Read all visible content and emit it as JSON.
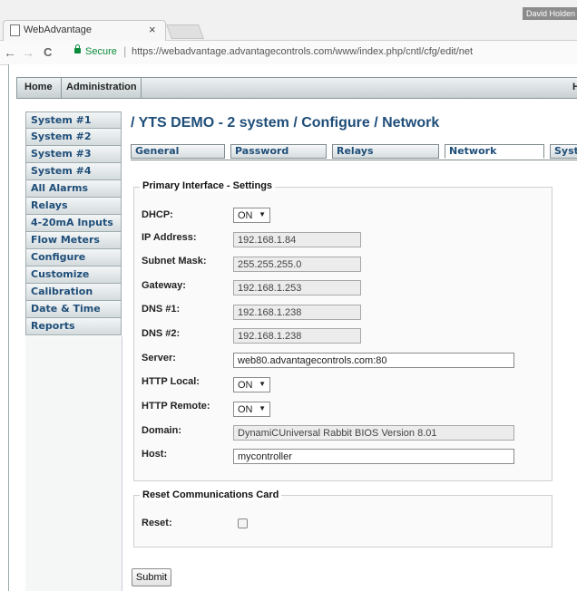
{
  "browser": {
    "tab_title": "WebAdvantage",
    "tab_close": "×",
    "user": "David Holden",
    "back": "←",
    "forward": "→",
    "reload": "C",
    "secure": "Secure",
    "separator": "|",
    "url": "https://webadvantage.advantagecontrols.com/www/index.php/cntl/cfg/edit/net"
  },
  "topbar": {
    "home": "Home",
    "admin": "Administration",
    "right": "H"
  },
  "sidebar": {
    "items": [
      {
        "label": "System #1"
      },
      {
        "label": "System #2"
      },
      {
        "label": "System #3"
      },
      {
        "label": "System #4"
      },
      {
        "label": "All Alarms"
      },
      {
        "label": "Relays"
      },
      {
        "label": "4-20mA Inputs"
      },
      {
        "label": "Flow Meters"
      },
      {
        "label": "Configure"
      },
      {
        "label": "Customize"
      },
      {
        "label": "Calibration"
      },
      {
        "label": "Date & Time"
      },
      {
        "label": "Reports"
      }
    ]
  },
  "page_title": "/ YTS DEMO - 2 system / Configure / Network",
  "tabs": [
    {
      "label": "General"
    },
    {
      "label": "Password"
    },
    {
      "label": "Relays"
    },
    {
      "label": "Network"
    },
    {
      "label": "Syst"
    }
  ],
  "primary": {
    "legend": "Primary Interface - Settings",
    "dhcp_label": "DHCP:",
    "dhcp_value": "ON",
    "ip_label": "IP Address:",
    "ip_value": "192.168.1.84",
    "subnet_label": "Subnet Mask:",
    "subnet_value": "255.255.255.0",
    "gateway_label": "Gateway:",
    "gateway_value": "192.168.1.253",
    "dns1_label": "DNS #1:",
    "dns1_value": "192.168.1.238",
    "dns2_label": "DNS #2:",
    "dns2_value": "192.168.1.238",
    "server_label": "Server:",
    "server_value": "web80.advantagecontrols.com:80",
    "http_local_label": "HTTP Local:",
    "http_local_value": "ON",
    "http_remote_label": "HTTP Remote:",
    "http_remote_value": "ON",
    "domain_label": "Domain:",
    "domain_value": "DynamiCUniversal Rabbit BIOS Version 8.01",
    "host_label": "Host:",
    "host_value": "mycontroller"
  },
  "reset": {
    "legend": "Reset Communications Card",
    "reset_label": "Reset:",
    "checked": false
  },
  "submit_label": "Submit",
  "select_arrow": "▼"
}
